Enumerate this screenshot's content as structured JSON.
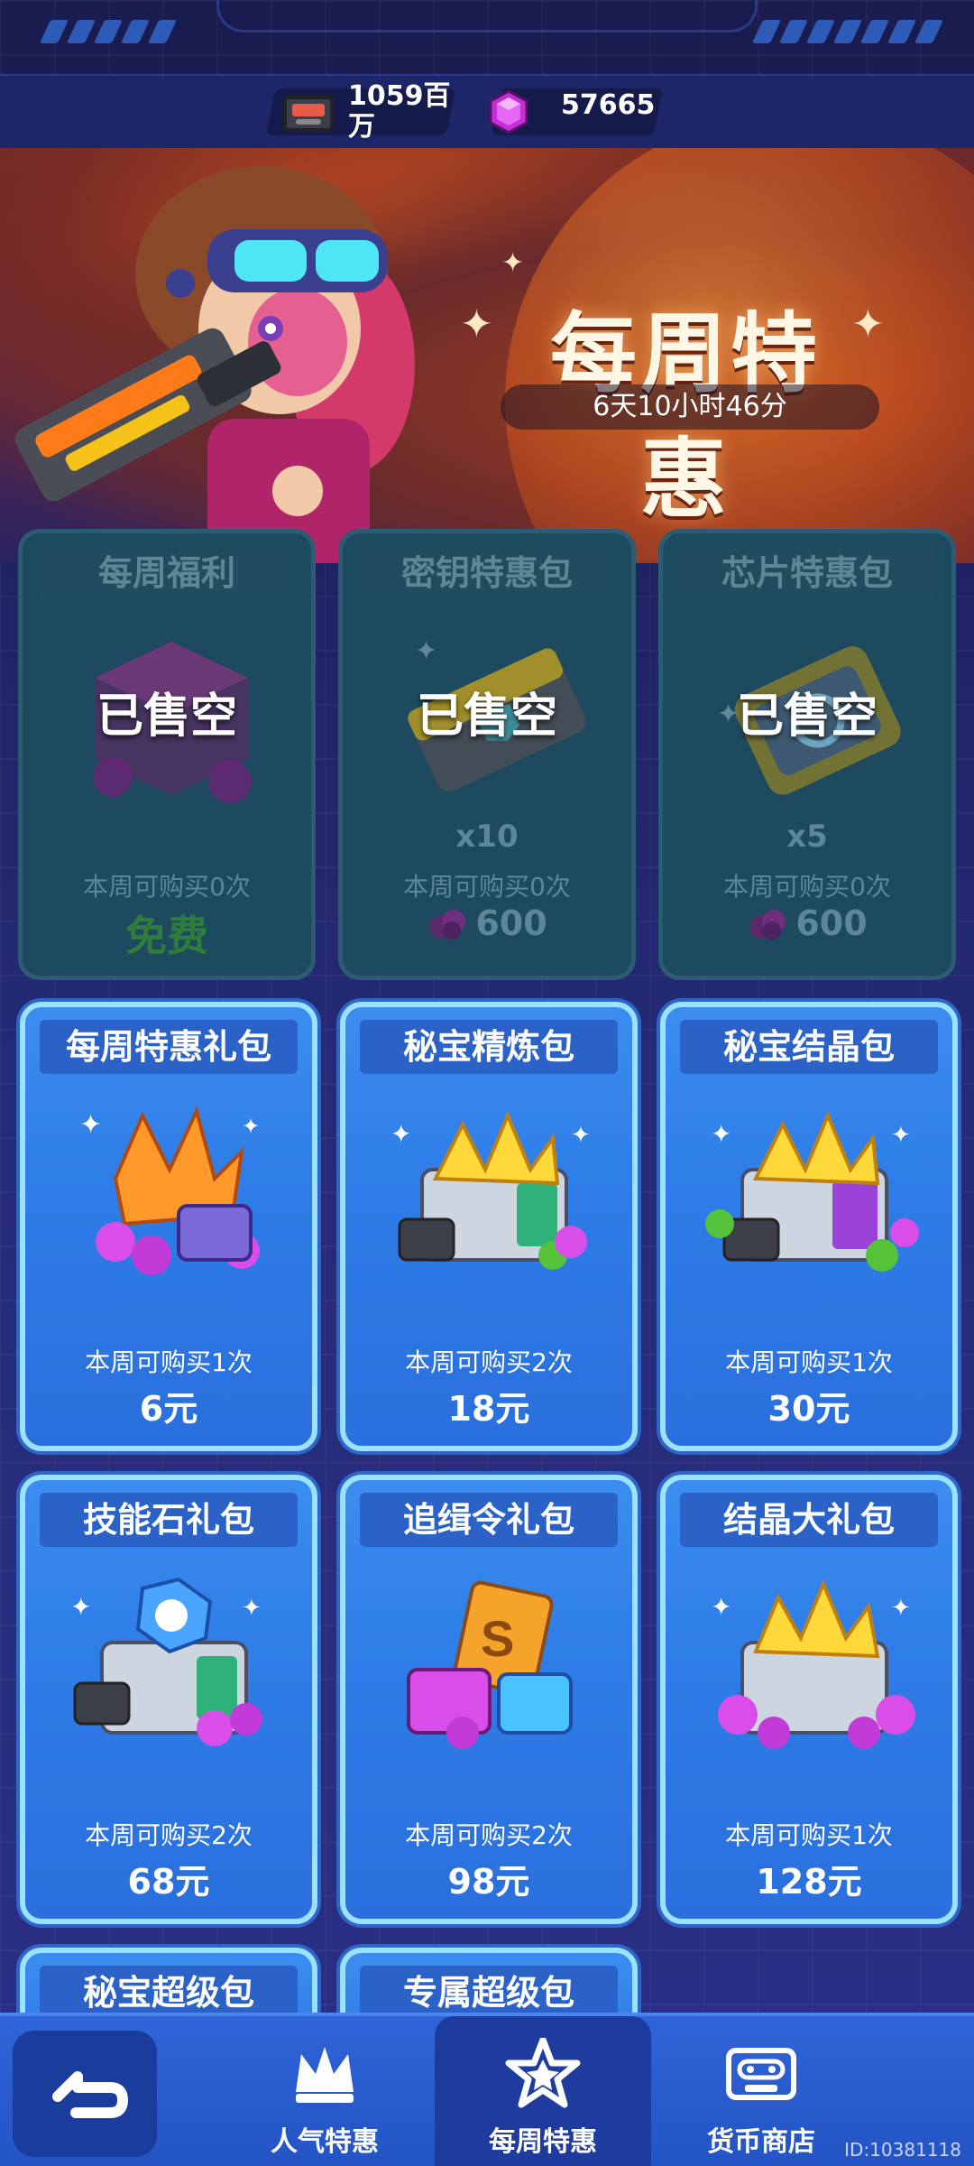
{
  "currency": {
    "tape_amount": "1059百\n万",
    "gem_amount": "57665"
  },
  "hero": {
    "title": "每周特惠",
    "timer": "6天10小时46分"
  },
  "sold_cards": [
    {
      "title": "每周福利",
      "status": "已售空",
      "qty": "",
      "limit": "本周可购买0次",
      "price": "免费",
      "has_gem": false
    },
    {
      "title": "密钥特惠包",
      "status": "已售空",
      "qty": "x10",
      "limit": "本周可购买0次",
      "price": "600",
      "has_gem": true
    },
    {
      "title": "芯片特惠包",
      "status": "已售空",
      "qty": "x5",
      "limit": "本周可购买0次",
      "price": "600",
      "has_gem": true
    }
  ],
  "packs_row1": [
    {
      "title": "每周特惠礼包",
      "limit": "本周可购买1次",
      "price": "6元"
    },
    {
      "title": "秘宝精炼包",
      "limit": "本周可购买2次",
      "price": "18元"
    },
    {
      "title": "秘宝结晶包",
      "limit": "本周可购买1次",
      "price": "30元"
    }
  ],
  "packs_row2": [
    {
      "title": "技能石礼包",
      "limit": "本周可购买2次",
      "price": "68元"
    },
    {
      "title": "追缉令礼包",
      "limit": "本周可购买2次",
      "price": "98元"
    },
    {
      "title": "结晶大礼包",
      "limit": "本周可购买1次",
      "price": "128元"
    }
  ],
  "packs_row3": [
    {
      "title": "秘宝超级包"
    },
    {
      "title": "专属超级包"
    }
  ],
  "nav": {
    "items": [
      {
        "label": "人气特惠",
        "icon": "crown-icon"
      },
      {
        "label": "每周特惠",
        "icon": "star-badge-icon"
      },
      {
        "label": "货币商店",
        "icon": "tape-icon"
      }
    ],
    "active": "每周特惠"
  },
  "footer": {
    "id_text": "ID:10381118"
  },
  "colors": {
    "sold_card_bg": "#1d4a5e",
    "pack_card_bg": "#3c8df0",
    "nav_bg": "#2f64d8",
    "free_text": "#2e7d3c"
  }
}
